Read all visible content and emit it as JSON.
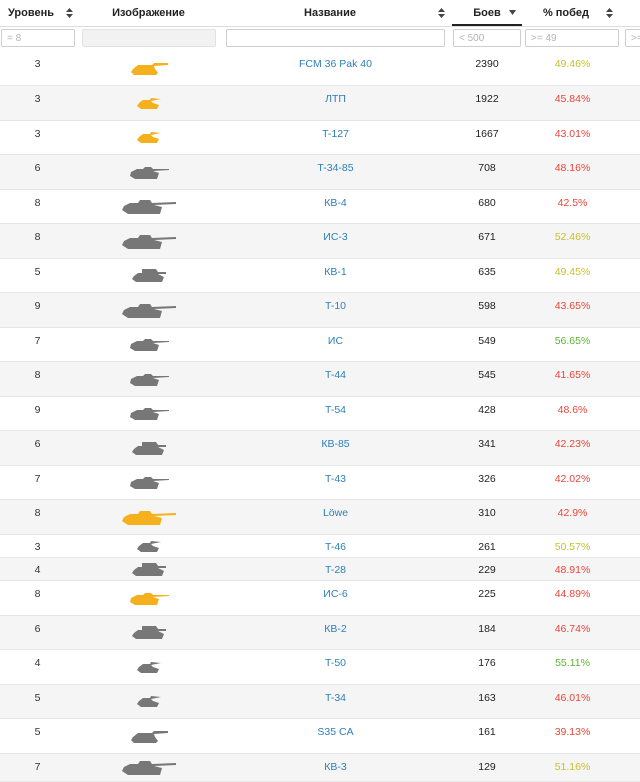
{
  "headers": {
    "level": "Уровень",
    "image": "Изображение",
    "name": "Название",
    "battles": "Боев",
    "winrate": "% побед"
  },
  "filters": {
    "level": "= 8",
    "name": "",
    "battles": "< 500",
    "winrate": ">= 49",
    "extra": ">="
  },
  "colors": {
    "tank_premium": "#f5b01d",
    "tank_regular": "#777777",
    "name_link": "#2e7fb8",
    "win_high": "#5bb531",
    "win_mid": "#c9c128",
    "win_low": "#e8463a"
  },
  "rows": [
    {
      "level": "3",
      "name": "FCM 36 Pak 40",
      "battles": "2390",
      "winrate": "49.46%",
      "win_color": "#c9c128",
      "tank_color": "#f5b01d",
      "tank_shape": "td"
    },
    {
      "level": "3",
      "name": "ЛТП",
      "battles": "1922",
      "winrate": "45.84%",
      "win_color": "#e8463a",
      "tank_color": "#f5b01d",
      "tank_shape": "light"
    },
    {
      "level": "3",
      "name": "T-127",
      "battles": "1667",
      "winrate": "43.01%",
      "win_color": "#e8463a",
      "tank_color": "#f5b01d",
      "tank_shape": "light"
    },
    {
      "level": "6",
      "name": "T-34-85",
      "battles": "708",
      "winrate": "48.16%",
      "win_color": "#e8463a",
      "tank_color": "#777777",
      "tank_shape": "medium"
    },
    {
      "level": "8",
      "name": "КВ-4",
      "battles": "680",
      "winrate": "42.5%",
      "win_color": "#e8463a",
      "tank_color": "#777777",
      "tank_shape": "heavy"
    },
    {
      "level": "8",
      "name": "ИС-3",
      "battles": "671",
      "winrate": "52.46%",
      "win_color": "#c9c128",
      "tank_color": "#777777",
      "tank_shape": "heavy"
    },
    {
      "level": "5",
      "name": "КВ-1",
      "battles": "635",
      "winrate": "49.45%",
      "win_color": "#c9c128",
      "tank_color": "#777777",
      "tank_shape": "box"
    },
    {
      "level": "9",
      "name": "T-10",
      "battles": "598",
      "winrate": "43.65%",
      "win_color": "#e8463a",
      "tank_color": "#777777",
      "tank_shape": "heavy"
    },
    {
      "level": "7",
      "name": "ИС",
      "battles": "549",
      "winrate": "56.65%",
      "win_color": "#5bb531",
      "tank_color": "#777777",
      "tank_shape": "medium"
    },
    {
      "level": "8",
      "name": "T-44",
      "battles": "545",
      "winrate": "41.65%",
      "win_color": "#e8463a",
      "tank_color": "#777777",
      "tank_shape": "medium"
    },
    {
      "level": "9",
      "name": "T-54",
      "battles": "428",
      "winrate": "48.6%",
      "win_color": "#e8463a",
      "tank_color": "#777777",
      "tank_shape": "medium"
    },
    {
      "level": "6",
      "name": "КВ-85",
      "battles": "341",
      "winrate": "42.23%",
      "win_color": "#e8463a",
      "tank_color": "#777777",
      "tank_shape": "box"
    },
    {
      "level": "7",
      "name": "T-43",
      "battles": "326",
      "winrate": "42.02%",
      "win_color": "#e8463a",
      "tank_color": "#777777",
      "tank_shape": "medium"
    },
    {
      "level": "8",
      "name": "Löwe",
      "battles": "310",
      "winrate": "42.9%",
      "win_color": "#e8463a",
      "tank_color": "#f5b01d",
      "tank_shape": "heavy"
    },
    {
      "level": "3",
      "name": "T-46",
      "battles": "261",
      "winrate": "50.57%",
      "win_color": "#c9c128",
      "tank_color": "#777777",
      "tank_shape": "light"
    },
    {
      "level": "4",
      "name": "T-28",
      "battles": "229",
      "winrate": "48.91%",
      "win_color": "#e8463a",
      "tank_color": "#777777",
      "tank_shape": "box"
    },
    {
      "level": "8",
      "name": "ИС-6",
      "battles": "225",
      "winrate": "44.89%",
      "win_color": "#e8463a",
      "tank_color": "#f5b01d",
      "tank_shape": "medium"
    },
    {
      "level": "6",
      "name": "КВ-2",
      "battles": "184",
      "winrate": "46.74%",
      "win_color": "#e8463a",
      "tank_color": "#777777",
      "tank_shape": "box"
    },
    {
      "level": "4",
      "name": "T-50",
      "battles": "176",
      "winrate": "55.11%",
      "win_color": "#5bb531",
      "tank_color": "#777777",
      "tank_shape": "light"
    },
    {
      "level": "5",
      "name": "T-34",
      "battles": "163",
      "winrate": "46.01%",
      "win_color": "#e8463a",
      "tank_color": "#777777",
      "tank_shape": "light"
    },
    {
      "level": "5",
      "name": "S35 CA",
      "battles": "161",
      "winrate": "39.13%",
      "win_color": "#e8463a",
      "tank_color": "#777777",
      "tank_shape": "td"
    },
    {
      "level": "7",
      "name": "КВ-3",
      "battles": "129",
      "winrate": "51.16%",
      "win_color": "#c9c128",
      "tank_color": "#777777",
      "tank_shape": "heavy"
    }
  ]
}
